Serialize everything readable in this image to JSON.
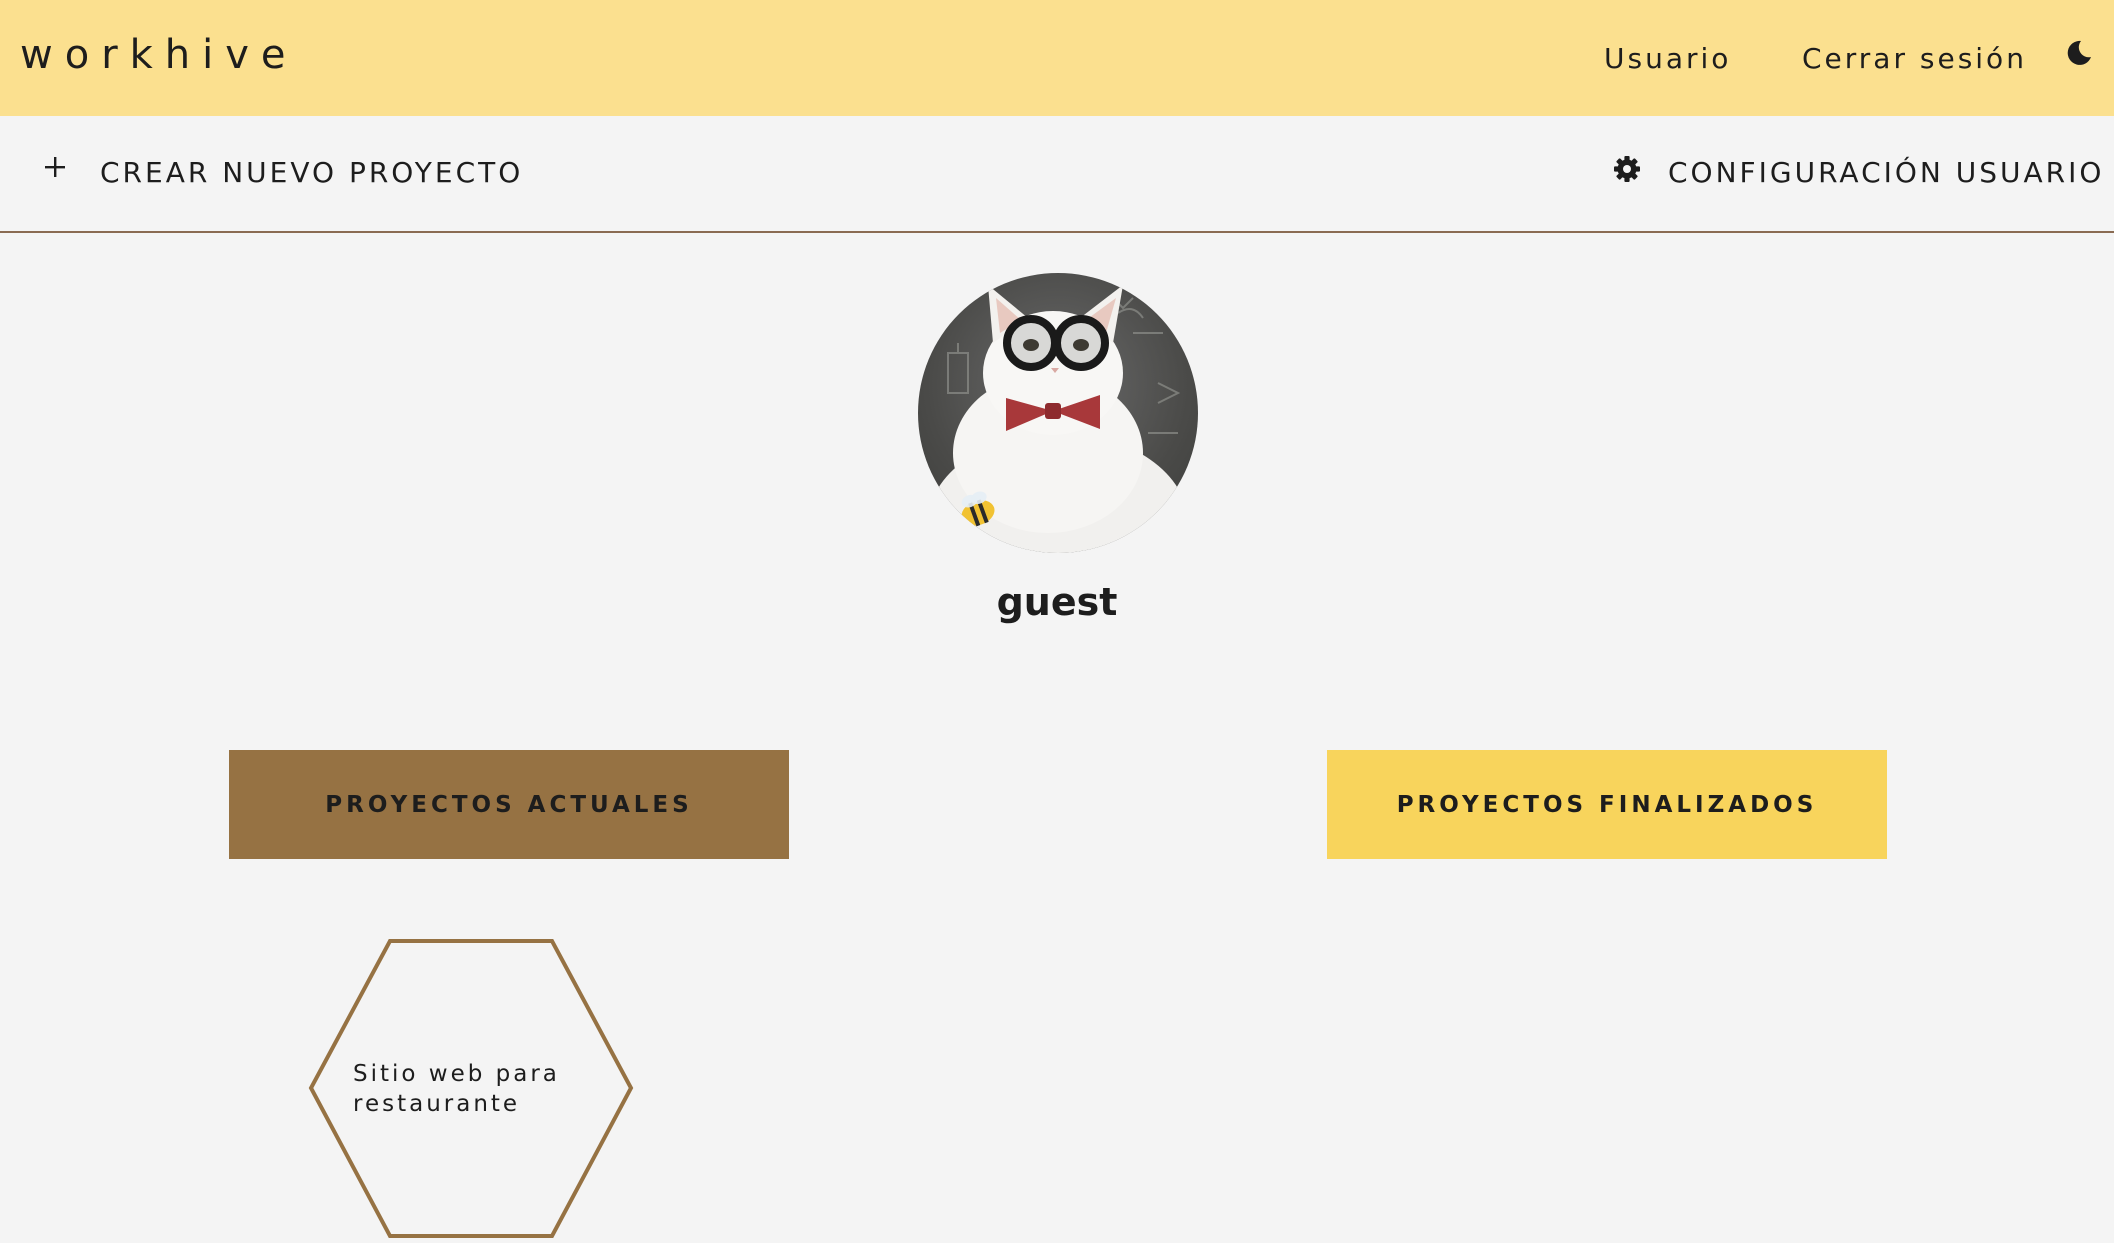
{
  "header": {
    "brand": "workhive",
    "nav": {
      "usuario": "Usuario",
      "logout": "Cerrar sesión"
    },
    "theme_toggle_icon": "moon-icon"
  },
  "toolbar": {
    "create_label": "CREAR NUEVO PROYECTO",
    "create_icon": "plus-icon",
    "config_label": "CONFIGURACIÓN USUARIO",
    "config_icon": "gear-icon"
  },
  "profile": {
    "username": "guest",
    "avatar": "cat-with-glasses-and-bowtie-avatar"
  },
  "tabs": {
    "current": "PROYECTOS ACTUALES",
    "finished": "PROYECTOS FINALIZADOS"
  },
  "projects": [
    {
      "title": "Sitio web para restaurante"
    }
  ],
  "colors": {
    "header_bg": "#fbe08f",
    "page_bg": "#f4f4f4",
    "tab_current": "#967243",
    "tab_finished": "#f8d45c",
    "hex_border": "#967243",
    "divider": "#8a6b52"
  }
}
